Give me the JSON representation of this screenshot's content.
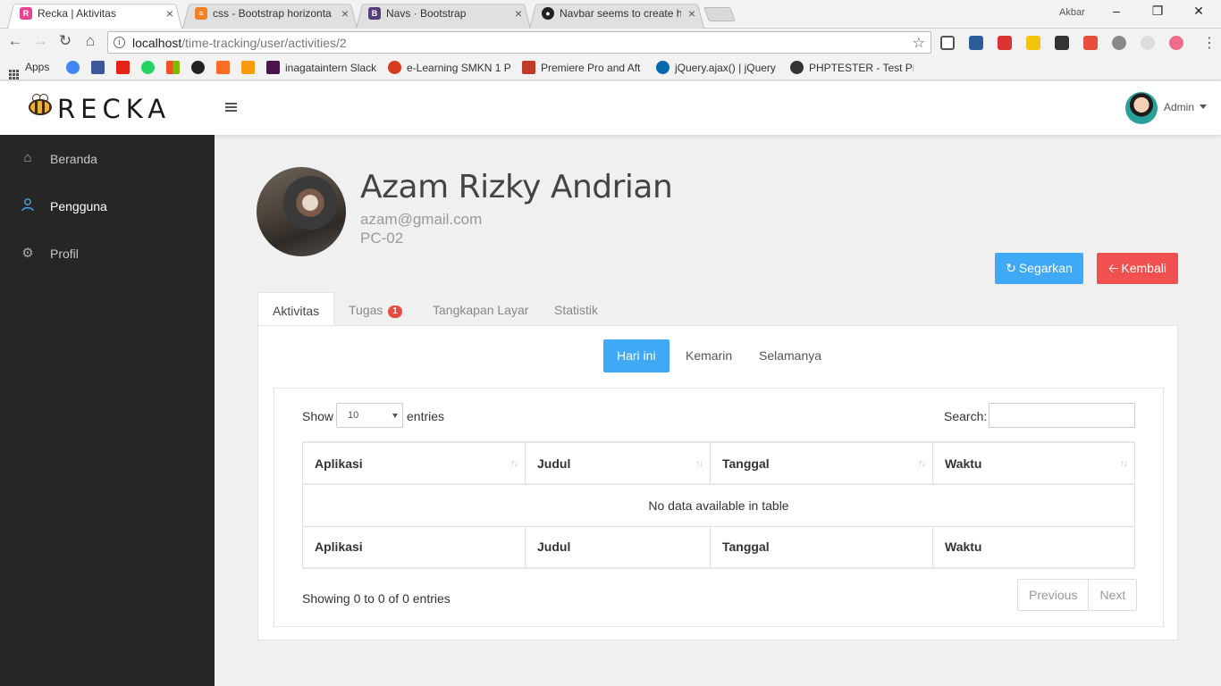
{
  "browser": {
    "tabs": [
      {
        "title": "Recka | Aktivitas",
        "favicon_color": "#e84393",
        "active": true
      },
      {
        "title": "css - Bootstrap horizonta",
        "favicon_color": "#f48024",
        "active": false
      },
      {
        "title": "Navs · Bootstrap",
        "favicon_color": "#563d7c",
        "active": false
      },
      {
        "title": "Navbar seems to create h",
        "favicon_color": "#222222",
        "active": false
      }
    ],
    "user": "Akbar",
    "url_host": "localhost",
    "url_path": "/time-tracking/user/activities/2",
    "bookmarks": [
      {
        "label": "Apps",
        "icon": "apps-grid-icon"
      },
      {
        "label": "",
        "icon": "google-icon",
        "color": "#4285f4"
      },
      {
        "label": "",
        "icon": "facebook-icon",
        "color": "#3b5998"
      },
      {
        "label": "",
        "icon": "youtube-icon",
        "color": "#e62117"
      },
      {
        "label": "",
        "icon": "whatsapp-icon",
        "color": "#25d366"
      },
      {
        "label": "",
        "icon": "microsoft-icon",
        "color": "#f25022"
      },
      {
        "label": "",
        "icon": "github-icon",
        "color": "#222222"
      },
      {
        "label": "",
        "icon": "gitlab-icon",
        "color": "#fc6d26"
      },
      {
        "label": "",
        "icon": "phpmyadmin-icon",
        "color": "#f89c0e"
      },
      {
        "label": "inagataintern Slack",
        "icon": "slack-icon",
        "color": "#4a154b"
      },
      {
        "label": "e-Learning SMKN 1 P",
        "icon": "elearning-icon",
        "color": "#d63b1f"
      },
      {
        "label": "Premiere Pro and Aft",
        "icon": "premiere-icon",
        "color": "#c0392b"
      },
      {
        "label": "jQuery.ajax() | jQuery",
        "icon": "jquery-icon",
        "color": "#0769ad"
      },
      {
        "label": "PHPTESTER - Test PH",
        "icon": "phptester-icon",
        "color": "#333333"
      }
    ]
  },
  "app": {
    "brand": "RECKA",
    "user": {
      "name": "Admin"
    },
    "sidebar": {
      "items": [
        {
          "label": "Beranda",
          "icon": "home-icon",
          "active": false
        },
        {
          "label": "Pengguna",
          "icon": "user-icon",
          "active": true
        },
        {
          "label": "Profil",
          "icon": "gear-icon",
          "active": false
        }
      ]
    },
    "profile": {
      "name": "Azam Rizky Andrian",
      "email": "azam@gmail.com",
      "pc": "PC-02"
    },
    "buttons": {
      "refresh": "Segarkan",
      "back": "Kembali"
    },
    "tabs": [
      {
        "label": "Aktivitas",
        "active": true
      },
      {
        "label": "Tugas",
        "badge": "1",
        "active": false
      },
      {
        "label": "Tangkapan Layar",
        "active": false
      },
      {
        "label": "Statistik",
        "active": false
      }
    ],
    "periods": [
      {
        "label": "Hari ini",
        "active": true
      },
      {
        "label": "Kemarin",
        "active": false
      },
      {
        "label": "Selamanya",
        "active": false
      }
    ],
    "datatable": {
      "show_label": "Show",
      "length_value": "10",
      "entries_label": "entries",
      "search_label": "Search:",
      "search_value": "",
      "columns": [
        "Aplikasi",
        "Judul",
        "Tanggal",
        "Waktu"
      ],
      "empty_message": "No data available in table",
      "info": "Showing 0 to 0 of 0 entries",
      "prev_label": "Previous",
      "next_label": "Next"
    },
    "colors": {
      "primary": "#3fa9f5",
      "danger": "#f0504f",
      "sidebar_bg": "#262626",
      "badge": "#e74c3c"
    }
  }
}
